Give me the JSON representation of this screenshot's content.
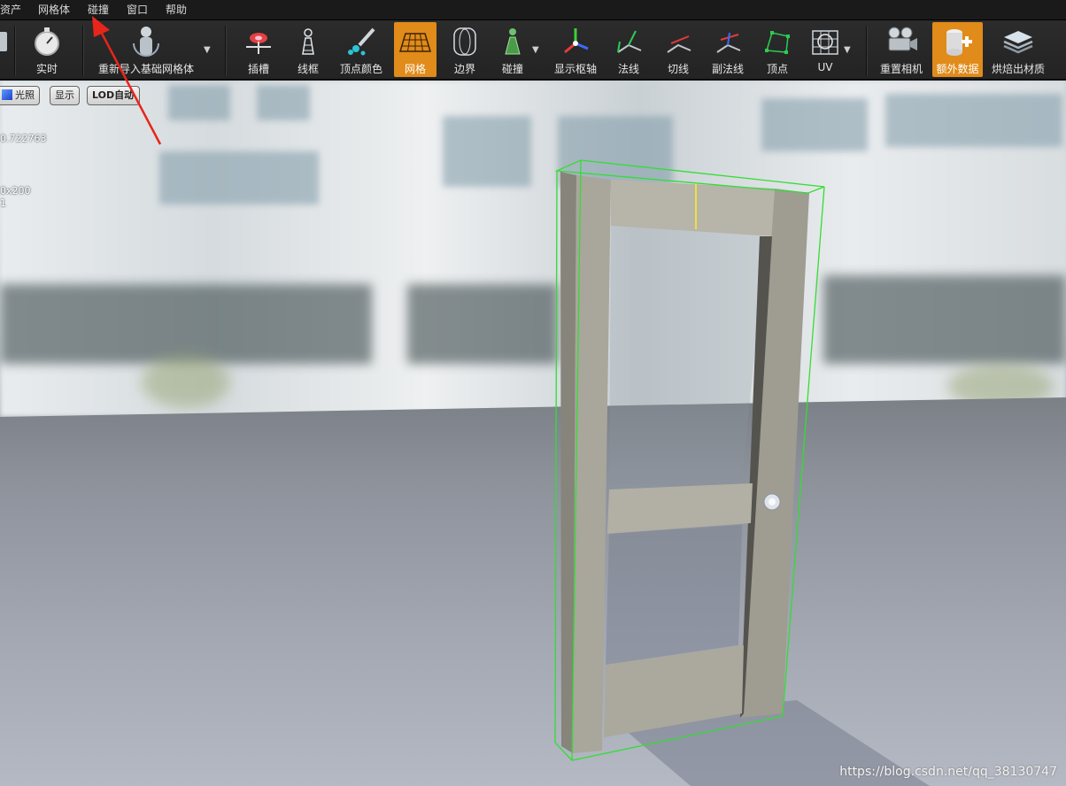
{
  "menu": {
    "items": [
      {
        "id": "assets",
        "label": "资产"
      },
      {
        "id": "mesh",
        "label": "网格体"
      },
      {
        "id": "collision",
        "label": "碰撞"
      },
      {
        "id": "window",
        "label": "窗口"
      },
      {
        "id": "help",
        "label": "帮助"
      }
    ]
  },
  "toolbar": {
    "realtime": "实时",
    "reimport": "重新导入基础网格体",
    "sockets": "插槽",
    "wireframe": "线框",
    "vertex_color": "顶点颜色",
    "grid": "网格",
    "bounds": "边界",
    "collision": "碰撞",
    "pivot": "显示枢轴",
    "normals": "法线",
    "tangents": "切线",
    "binormals": "副法线",
    "vertices": "顶点",
    "uv": "UV",
    "reset_camera": "重置相机",
    "additional_data": "额外数据",
    "bake_material": "烘焙出材质"
  },
  "viewport": {
    "lighting_btn": "光照",
    "show_btn": "显示",
    "lod_btn": "LOD自动",
    "stat_line1": "0.722763",
    "stat_line2": "0x200",
    "stat_line3": "1",
    "watermark": "https://blog.csdn.net/qq_38130747"
  },
  "colors": {
    "accent": "#e08b1a",
    "bounds": "#33dd33",
    "annotation_arrow": "#e8251b"
  }
}
